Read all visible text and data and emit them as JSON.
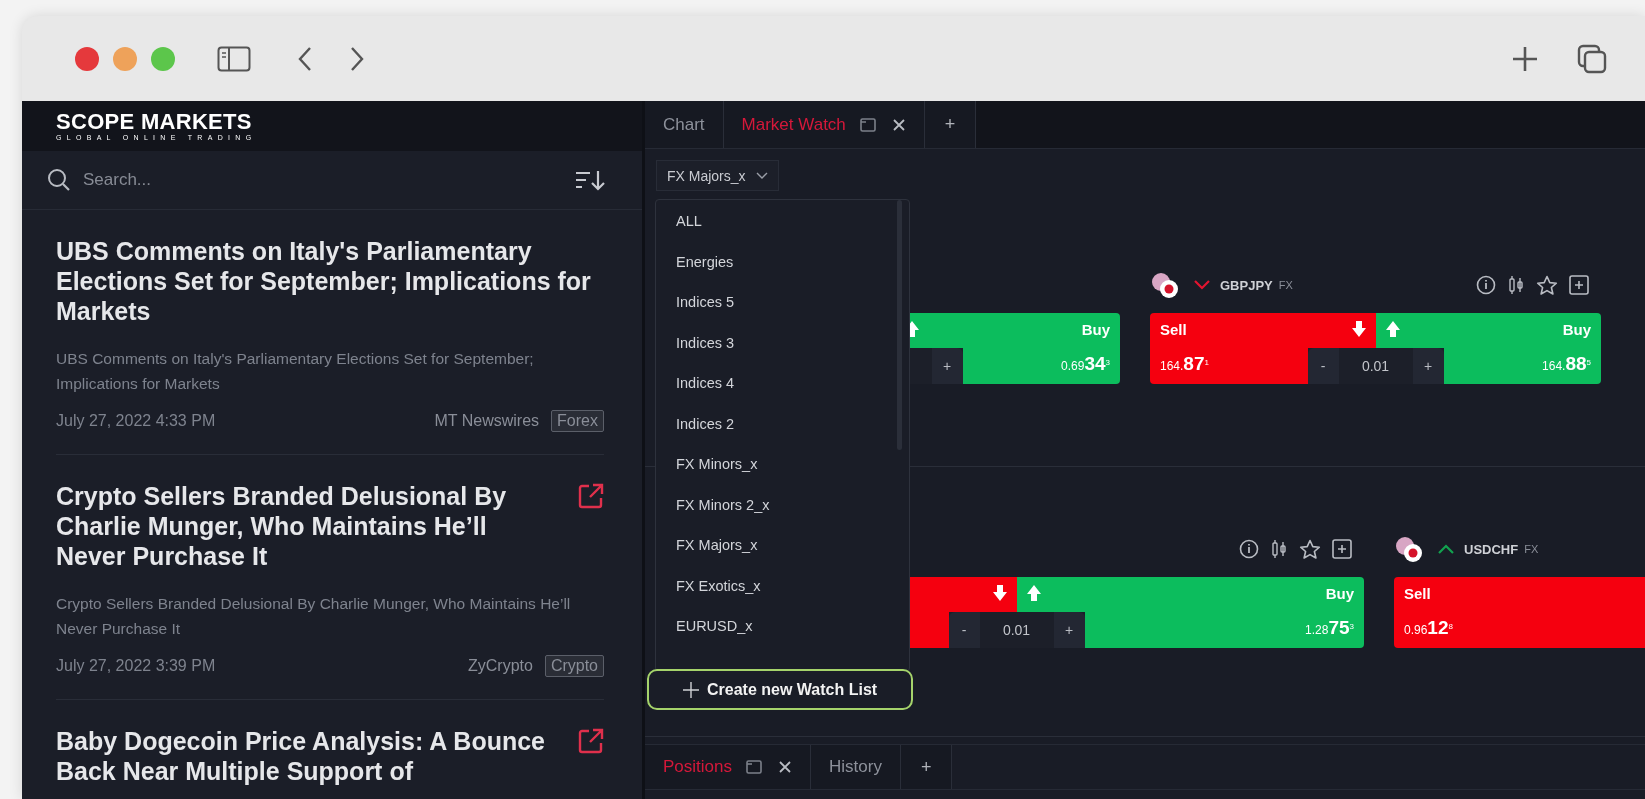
{
  "news": {
    "logo": "SCOPE MARKETS",
    "tagline": "GLOBAL ONLINE TRADING",
    "search": {
      "placeholder": "Search..."
    },
    "items": [
      {
        "title": "UBS Comments on Italy's Parliamentary Elections Set for September; Implications for Markets",
        "summary": "UBS Comments on Italy's Parliamentary Elections Set for September; Implications for Markets",
        "date": "July 27, 2022 4:33 PM",
        "source": "MT Newswires",
        "tag": "Forex",
        "external_link": false
      },
      {
        "title": "Crypto Sellers Branded Delusional By Charlie Munger, Who Maintains He’ll Never Purchase It",
        "summary": "Crypto Sellers Branded Delusional By Charlie Munger, Who Maintains He’ll Never Purchase It",
        "date": "July 27, 2022 3:39 PM",
        "source": "ZyCrypto",
        "tag": "Crypto",
        "external_link": true
      },
      {
        "title": "Baby Dogecoin Price Analysis: A Bounce Back Near Multiple Support of",
        "external_link": true
      }
    ]
  },
  "workspace": {
    "tabs": [
      {
        "label": "Chart",
        "selected": false,
        "closable": false
      },
      {
        "label": "Market Watch",
        "selected": true,
        "closable": true
      }
    ],
    "add_tab": "+",
    "watchlist_selector": "FX Majors_x",
    "menu": {
      "items": [
        "ALL",
        "Energies",
        "Indices 5",
        "Indices 3",
        "Indices 4",
        "Indices 2",
        "FX Minors_x",
        "FX Minors 2_x",
        "FX Majors_x",
        "FX Exotics_x",
        "EURUSD_x"
      ],
      "create_button": "Create new Watch List"
    },
    "rows": [
      {
        "cards": [
          {
            "buy": {
              "label": "Buy",
              "price": "0.69**34**$^{3}$",
              "arrow": true
            },
            "lot": {
              "plus": "+"
            }
          },
          {
            "symbol": "GBPJPY",
            "market": "FX",
            "trend_up": false,
            "sell": {
              "label": "Sell",
              "price": "164.**87**$^{1}$",
              "arrow": true
            },
            "buy": {
              "label": "Buy",
              "price": "164.**88**$^{5}$",
              "arrow": true
            },
            "lot": {
              "minus": "-",
              "value": "0.01",
              "plus": "+"
            }
          }
        ]
      },
      {
        "cards": [
          {
            "sell": {
              "arrow": true
            },
            "buy": {
              "label": "Buy",
              "price": "1.28**75**$^{3}$",
              "arrow": true
            },
            "lot": {
              "minus": "-",
              "value": "0.01",
              "plus": "+"
            }
          },
          {
            "symbol": "USDCHF",
            "market": "FX",
            "trend_up": true,
            "sell": {
              "label": "Sell",
              "price": "0.96**12**$^{8}$",
              "arrow": false
            }
          }
        ]
      }
    ]
  },
  "bottom_panel": {
    "tabs": [
      {
        "label": "Positions",
        "selected": true,
        "closable": true
      },
      {
        "label": "History",
        "selected": false,
        "closable": false
      }
    ],
    "add_tab": "+"
  }
}
